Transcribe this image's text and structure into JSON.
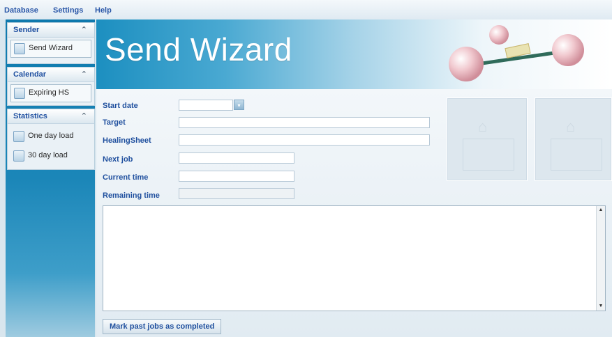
{
  "menubar": {
    "items": [
      "Database",
      "Settings",
      "Help"
    ]
  },
  "sidebar": {
    "groups": [
      {
        "title": "Sender",
        "items": [
          {
            "label": "Send Wizard",
            "icon": "document-icon"
          }
        ]
      },
      {
        "title": "Calendar",
        "items": [
          {
            "label": "Expiring HS",
            "icon": "copy-icon"
          }
        ]
      },
      {
        "title": "Statistics",
        "items": [
          {
            "label": "One day load",
            "icon": "screen-icon"
          },
          {
            "label": "30 day load",
            "icon": "screen-icon"
          }
        ]
      }
    ],
    "collapse_glyph": "⌃"
  },
  "banner": {
    "title": "Send Wizard"
  },
  "form": {
    "start_date": {
      "label": "Start date",
      "value": ""
    },
    "target": {
      "label": "Target",
      "value": ""
    },
    "healing_sheet": {
      "label": "HealingSheet",
      "value": ""
    },
    "next_job": {
      "label": "Next job",
      "value": ""
    },
    "current_time": {
      "label": "Current time",
      "value": ""
    },
    "remaining_time": {
      "label": "Remaining time",
      "value": ""
    }
  },
  "log": {
    "text": ""
  },
  "actions": {
    "mark_past_jobs": "Mark past jobs as completed"
  },
  "colors": {
    "accent": "#1e4fa0",
    "sidebar": "#1b86b8",
    "banner": "#4aa9d2"
  }
}
